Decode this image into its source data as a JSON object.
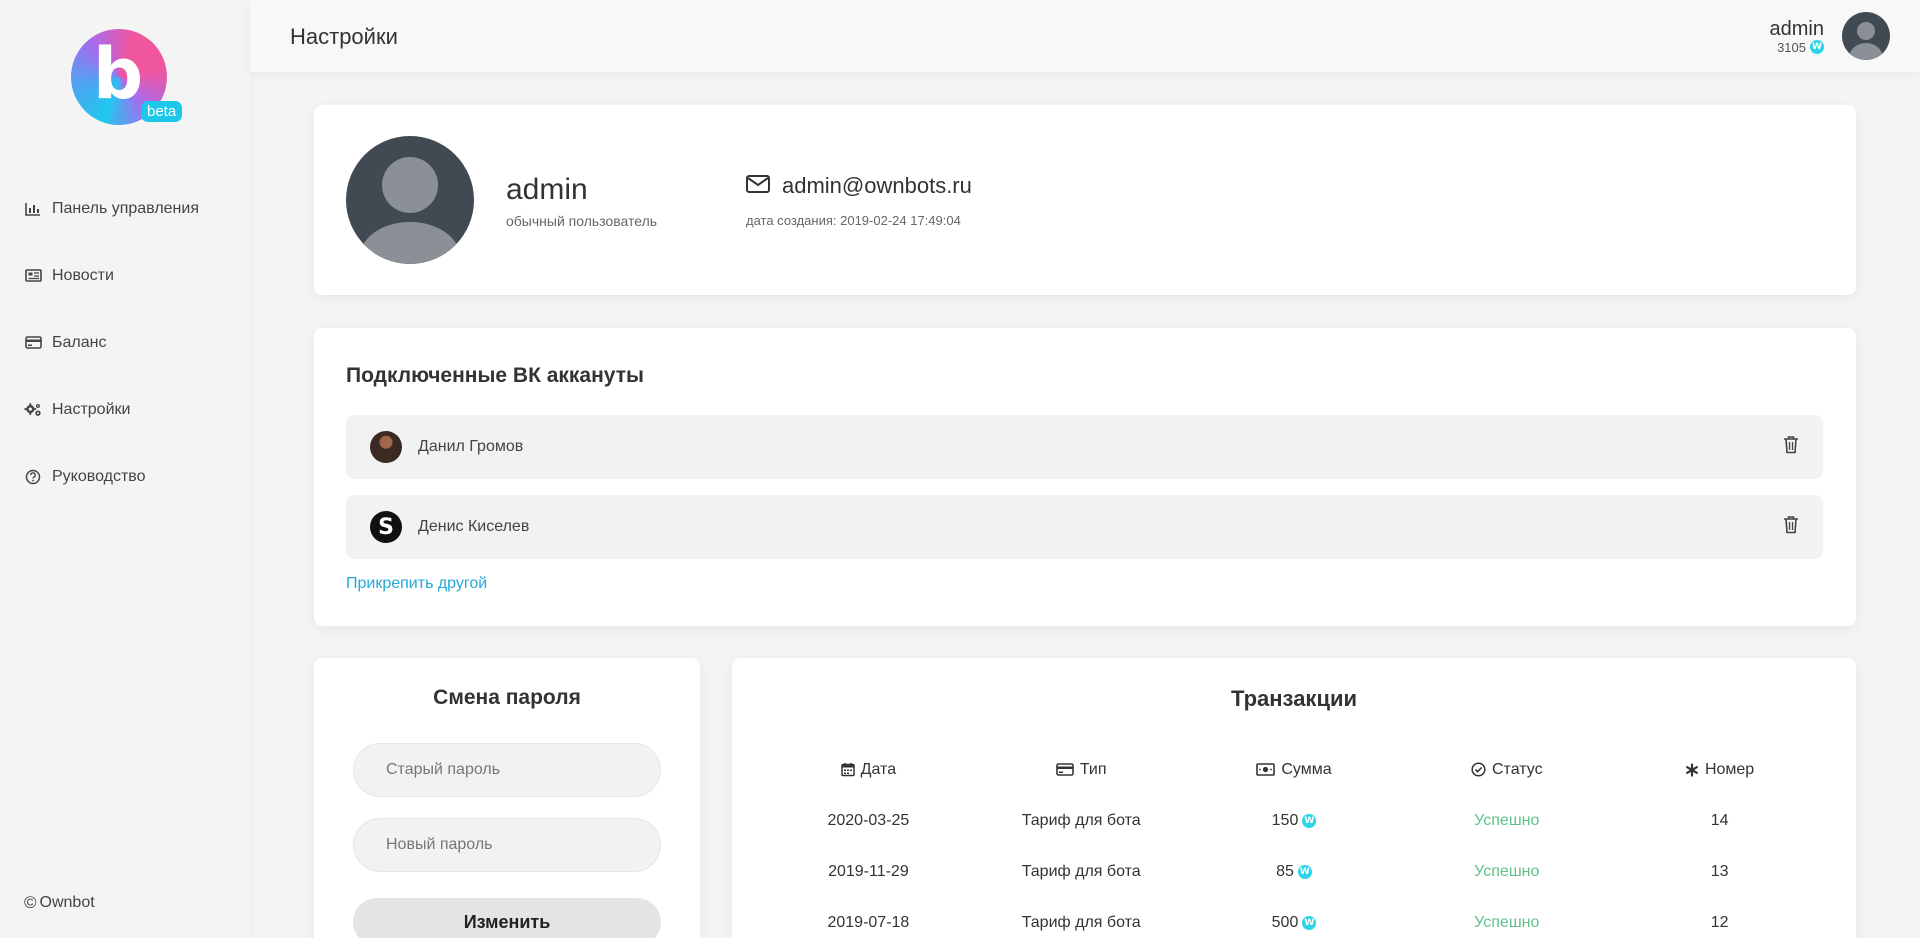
{
  "sidebar": {
    "logo_letter": "b",
    "logo_badge": "beta",
    "items": [
      {
        "label": "Панель управления",
        "icon": "bar-chart-icon"
      },
      {
        "label": "Новости",
        "icon": "newspaper-icon"
      },
      {
        "label": "Баланс",
        "icon": "credit-card-icon"
      },
      {
        "label": "Настройки",
        "icon": "gears-icon"
      },
      {
        "label": "Руководство",
        "icon": "question-circle-icon"
      }
    ],
    "copyright": "Ownbot"
  },
  "header": {
    "title": "Настройки",
    "username": "admin",
    "balance": "3105",
    "coin_symbol": "W"
  },
  "profile": {
    "name": "admin",
    "role": "обычный пользователь",
    "email": "admin@ownbots.ru",
    "created": "дата создания: 2019-02-24 17:49:04"
  },
  "vk": {
    "title": "Подключенные ВК аккануты",
    "accounts": [
      {
        "name": "Данил Громов"
      },
      {
        "name": "Денис Киселев"
      }
    ],
    "attach_link": "Прикрепить другой"
  },
  "password": {
    "title": "Смена пароля",
    "old_placeholder": "Старый пароль",
    "new_placeholder": "Новый пароль",
    "submit": "Изменить"
  },
  "transactions": {
    "title": "Транзакции",
    "columns": [
      "Дата",
      "Тип",
      "Сумма",
      "Статус",
      "Номер"
    ],
    "rows": [
      {
        "date": "2020-03-25",
        "type": "Тариф для бота",
        "amount": "150",
        "status": "Успешно",
        "number": "14"
      },
      {
        "date": "2019-11-29",
        "type": "Тариф для бота",
        "amount": "85",
        "status": "Успешно",
        "number": "13"
      },
      {
        "date": "2019-07-18",
        "type": "Тариф для бота",
        "amount": "500",
        "status": "Успешно",
        "number": "12"
      }
    ]
  },
  "colors": {
    "accent": "#25a8d6",
    "success": "#5fc28a",
    "coin": "#2bd4e8"
  }
}
